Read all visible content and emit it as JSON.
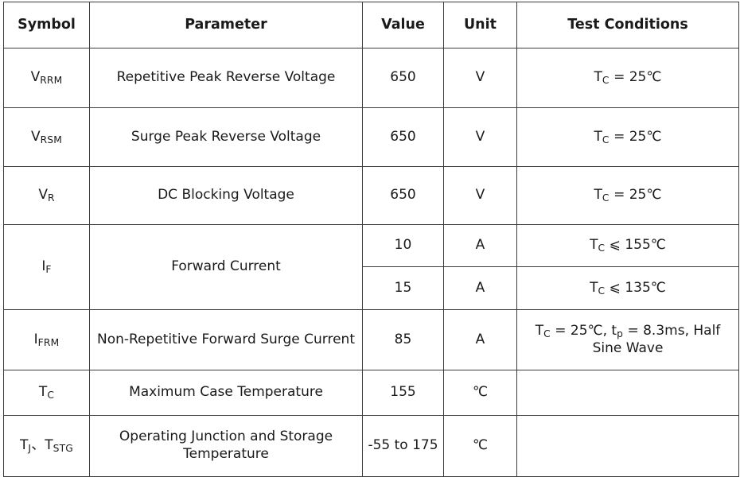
{
  "table": {
    "columns": [
      {
        "key": "symbol",
        "label": "Symbol"
      },
      {
        "key": "parameter",
        "label": "Parameter"
      },
      {
        "key": "value",
        "label": "Value"
      },
      {
        "key": "unit",
        "label": "Unit"
      },
      {
        "key": "conditions",
        "label": "Test Conditions"
      }
    ],
    "rows": [
      {
        "symbol_main": "V",
        "symbol_sub": "RRM",
        "parameter": "Repetitive Peak Reverse Voltage",
        "value": "650",
        "unit": "V",
        "cond_pre": "T",
        "cond_sub": "C",
        "cond_post": " = 25℃"
      },
      {
        "symbol_main": "V",
        "symbol_sub": "RSM",
        "parameter": "Surge Peak Reverse Voltage",
        "value": "650",
        "unit": "V",
        "cond_pre": "T",
        "cond_sub": "C",
        "cond_post": " = 25℃"
      },
      {
        "symbol_main": "V",
        "symbol_sub": "R",
        "parameter": "DC Blocking Voltage",
        "value": "650",
        "unit": "V",
        "cond_pre": "T",
        "cond_sub": "C",
        "cond_post": " = 25℃"
      },
      {
        "symbol_main": "I",
        "symbol_sub": "F",
        "parameter": "Forward Current",
        "value": "10",
        "unit": "A",
        "cond_pre": "T",
        "cond_sub": "C",
        "cond_post": " ⩽  155℃"
      },
      {
        "value": "15",
        "unit": "A",
        "cond_pre": "T",
        "cond_sub": "C",
        "cond_post": " ⩽  135℃"
      },
      {
        "symbol_main": "I",
        "symbol_sub": "FRM",
        "parameter": "Non-Repetitive Forward Surge Current",
        "value": "85",
        "unit": "A",
        "cond_pre": "T",
        "cond_sub": "C",
        "cond_post": " = 25℃, t",
        "cond_sub2": "p",
        "cond_post2": " = 8.3ms, Half Sine Wave"
      },
      {
        "symbol_main": "T",
        "symbol_sub": "C",
        "parameter": "Maximum Case Temperature",
        "value": "155",
        "unit": "℃",
        "cond_pre": "",
        "cond_sub": "",
        "cond_post": ""
      },
      {
        "symbol_main": "T",
        "symbol_sub": "J",
        "symbol_sep": "、",
        "symbol_main2": "T",
        "symbol_sub2": "STG",
        "parameter": "Operating Junction and Storage Temperature",
        "value": "-55 to 175",
        "unit": "℃",
        "cond_pre": "",
        "cond_sub": "",
        "cond_post": ""
      }
    ]
  },
  "style": {
    "border_color": "#3d3d3d",
    "text_color": "#1a1a1a",
    "background": "#ffffff"
  }
}
